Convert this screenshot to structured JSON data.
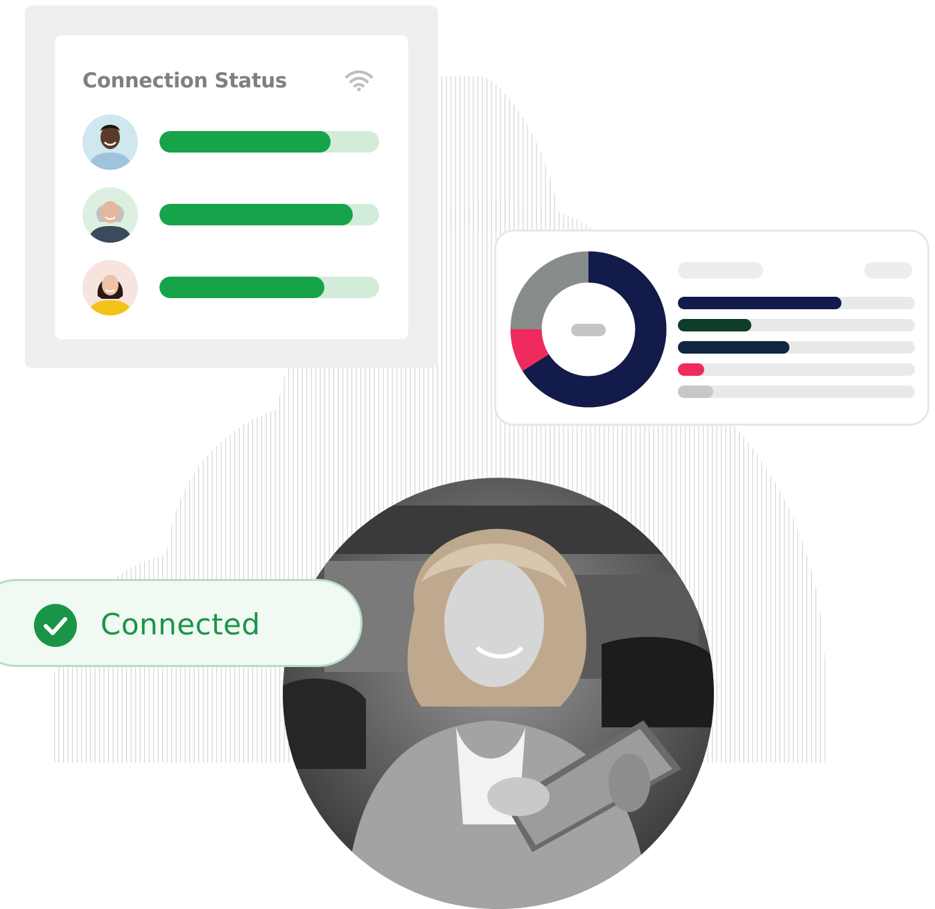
{
  "status_card": {
    "title": "Connection Status",
    "icon": "wifi-icon",
    "rows": [
      {
        "avatar": "avatar-man",
        "progress": 0.78
      },
      {
        "avatar": "avatar-older-woman",
        "progress": 0.88
      },
      {
        "avatar": "avatar-young-woman",
        "progress": 0.75
      }
    ],
    "colors": {
      "fill": "#17a34a",
      "track": "#d2ecda"
    }
  },
  "analytics_card": {
    "donut": [
      {
        "color": "#121b4a",
        "fraction": 0.66
      },
      {
        "color": "#ef2a5c",
        "fraction": 0.09
      },
      {
        "color": "#888c8b",
        "fraction": 0.25
      }
    ],
    "bars": [
      {
        "color": "#121b4a",
        "progress": 0.69
      },
      {
        "color": "#0e3d2a",
        "progress": 0.31
      },
      {
        "color": "#102540",
        "progress": 0.47
      },
      {
        "color": "#ef2a5c",
        "progress": 0.11
      },
      {
        "color": "#c6c9c8",
        "progress": 0.15
      }
    ]
  },
  "connected_badge": {
    "label": "Connected",
    "icon": "check-circle-icon",
    "color": "#1a9447"
  },
  "photo": {
    "description_icon": "woman-with-tablet-photo"
  }
}
